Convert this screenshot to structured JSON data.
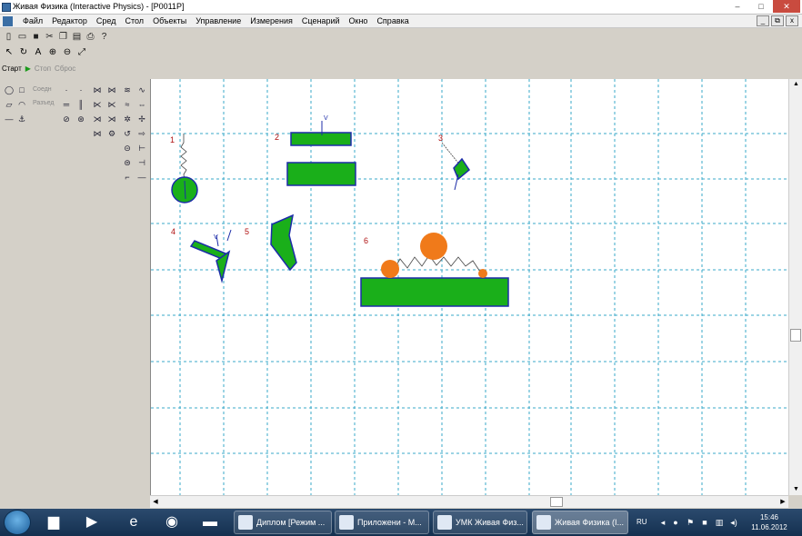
{
  "window": {
    "title": "Живая Физика (Interactive Physics) - [P0011P]",
    "controls": {
      "minimize": "–",
      "maximize": "□",
      "close": "✕"
    },
    "mdi_controls": {
      "minimize": "_",
      "restore": "⧉",
      "close": "x"
    }
  },
  "menu": [
    "Файл",
    "Редактор",
    "Сред",
    "Стол",
    "Объекты",
    "Управление",
    "Измерения",
    "Сценарий",
    "Окно",
    "Справка"
  ],
  "toolbar": {
    "file_icons": [
      "new-icon",
      "open-icon",
      "save-icon",
      "cut-icon",
      "copy-icon",
      "paste-icon",
      "print-icon",
      "help-icon"
    ],
    "tool_icons": [
      "arrow-icon",
      "rotate-icon",
      "text-icon",
      "zoom-in-icon",
      "zoom-out-icon",
      "fit-icon"
    ]
  },
  "runbar": {
    "start": "Старт",
    "stop": "Стоп",
    "reset": "Сброс"
  },
  "palette": {
    "connect_label": "Соедн",
    "split_label": "Разъед"
  },
  "canvas": {
    "labels": [
      "1",
      "2",
      "3",
      "4",
      "5",
      "6"
    ],
    "vector_label": "V",
    "colors": {
      "body_fill": "#1aaf1a",
      "body_stroke": "#1c2ca8",
      "grid": "#3aa8c8",
      "label": "#b01010",
      "ball_fill": "#f07a1a"
    }
  },
  "taskbar": {
    "tasks": [
      "Диплом [Режим ...",
      "Приложени - M...",
      "УМК Живая Физ...",
      "Живая Физика (I..."
    ],
    "language": "RU",
    "time": "15:46",
    "date": "11.06.2012"
  }
}
